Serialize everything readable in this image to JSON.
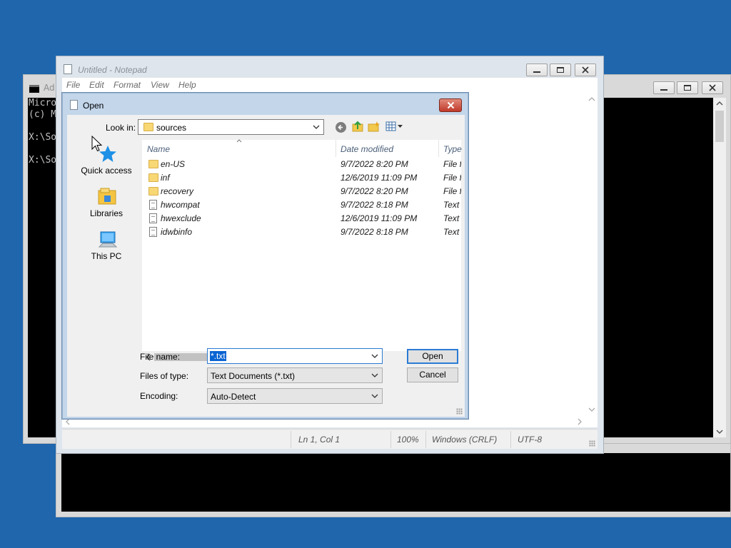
{
  "cmd": {
    "title": "Ad",
    "lines": [
      "Micro",
      "(c) M",
      "",
      "X:\\So",
      "",
      "X:\\So"
    ]
  },
  "notepad": {
    "title": "Untitled - Notepad",
    "menu": [
      "File",
      "Edit",
      "Format",
      "View",
      "Help"
    ],
    "status": {
      "position": "Ln 1, Col 1",
      "zoom": "100%",
      "line_endings": "Windows (CRLF)",
      "encoding": "UTF-8"
    }
  },
  "dialog": {
    "title": "Open",
    "look_in_label": "Look in:",
    "look_in_value": "sources",
    "places": [
      {
        "label": "Quick access",
        "icon": "star-icon"
      },
      {
        "label": "Libraries",
        "icon": "libraries-icon"
      },
      {
        "label": "This PC",
        "icon": "computer-icon"
      }
    ],
    "columns": [
      "Name",
      "Date modified",
      "Type"
    ],
    "files": [
      {
        "name": "en-US",
        "date": "9/7/2022 8:20 PM",
        "type": "File fo",
        "kind": "folder"
      },
      {
        "name": "inf",
        "date": "12/6/2019 11:09 PM",
        "type": "File fo",
        "kind": "folder"
      },
      {
        "name": "recovery",
        "date": "9/7/2022 8:20 PM",
        "type": "File fo",
        "kind": "folder"
      },
      {
        "name": "hwcompat",
        "date": "9/7/2022 8:18 PM",
        "type": "Text D",
        "kind": "file"
      },
      {
        "name": "hwexclude",
        "date": "12/6/2019 11:09 PM",
        "type": "Text D",
        "kind": "file"
      },
      {
        "name": "idwbinfo",
        "date": "9/7/2022 8:18 PM",
        "type": "Text D",
        "kind": "file"
      }
    ],
    "file_name_label": "File name:",
    "file_name_value": "*.txt",
    "files_of_type_label": "Files of type:",
    "files_of_type_value": "Text Documents (*.txt)",
    "encoding_label": "Encoding:",
    "encoding_value": "Auto-Detect",
    "open_button": "Open",
    "cancel_button": "Cancel"
  }
}
